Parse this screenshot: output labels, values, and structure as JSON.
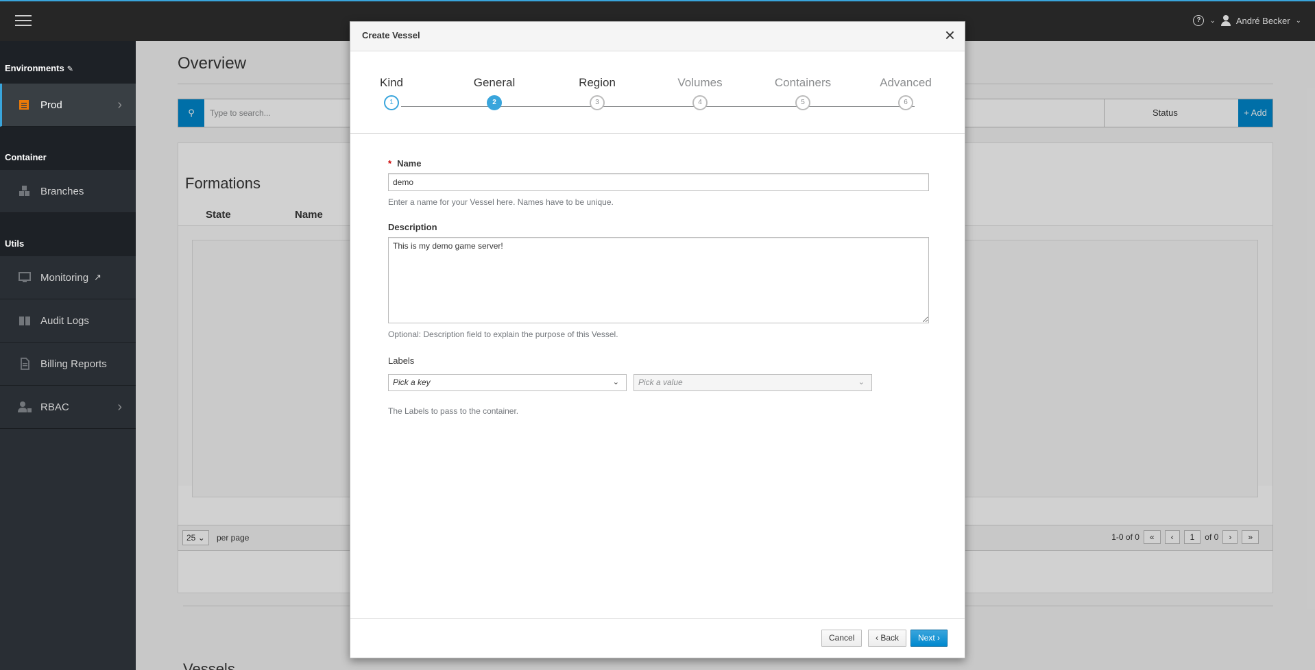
{
  "topbar": {
    "user_name": "André Becker",
    "help_glyph": "?"
  },
  "sidebar": {
    "env_section": "Environments",
    "container_section": "Container",
    "utils_section": "Utils",
    "items": {
      "prod": "Prod",
      "branches": "Branches",
      "monitoring": "Monitoring",
      "audit_logs": "Audit Logs",
      "billing": "Billing Reports",
      "rbac": "RBAC"
    }
  },
  "main": {
    "title": "Overview",
    "search_placeholder": "Type to search...",
    "status_label": "Status",
    "add_label": "+ Add",
    "formations_title": "Formations",
    "col_state": "State",
    "col_name": "Name",
    "per_page_value": "25",
    "per_page_label": "per page",
    "range_text": "1-0 of 0",
    "page_input": "1",
    "page_of": "of 0",
    "vessels_title": "Vessels"
  },
  "modal": {
    "title": "Create Vessel",
    "close": "×",
    "steps": [
      {
        "label": "Kind",
        "num": "1"
      },
      {
        "label": "General",
        "num": "2"
      },
      {
        "label": "Region",
        "num": "3"
      },
      {
        "label": "Volumes",
        "num": "4"
      },
      {
        "label": "Containers",
        "num": "5"
      },
      {
        "label": "Advanced",
        "num": "6"
      }
    ],
    "name_label": "Name",
    "name_required": "*",
    "name_value": "demo",
    "name_help": "Enter a name for your Vessel here. Names have to be unique.",
    "desc_label": "Description",
    "desc_value": "This is my demo game server!",
    "desc_help": "Optional: Description field to explain the purpose of this Vessel.",
    "labels_label": "Labels",
    "key_placeholder": "Pick a key",
    "value_placeholder": "Pick a value",
    "labels_help": "The Labels to pass to the container.",
    "cancel": "Cancel",
    "back": "Back",
    "next": "Next"
  },
  "colors": {
    "accent": "#39a5dc",
    "primary": "#0088ce",
    "sidebar_bg": "#292e34",
    "topbar_bg": "#262626",
    "prod_icon": "#ec7a08"
  },
  "icons": {
    "menu": "hamburger-icon",
    "help": "question-circle-icon",
    "user": "user-icon",
    "edit": "pencil-icon",
    "prod": "folder-icon",
    "branches": "cubes-icon",
    "monitoring": "desktop-icon",
    "external": "external-link-icon",
    "audit": "book-icon",
    "billing": "file-icon",
    "rbac": "users-lock-icon",
    "search": "search-icon",
    "close": "close-icon"
  }
}
